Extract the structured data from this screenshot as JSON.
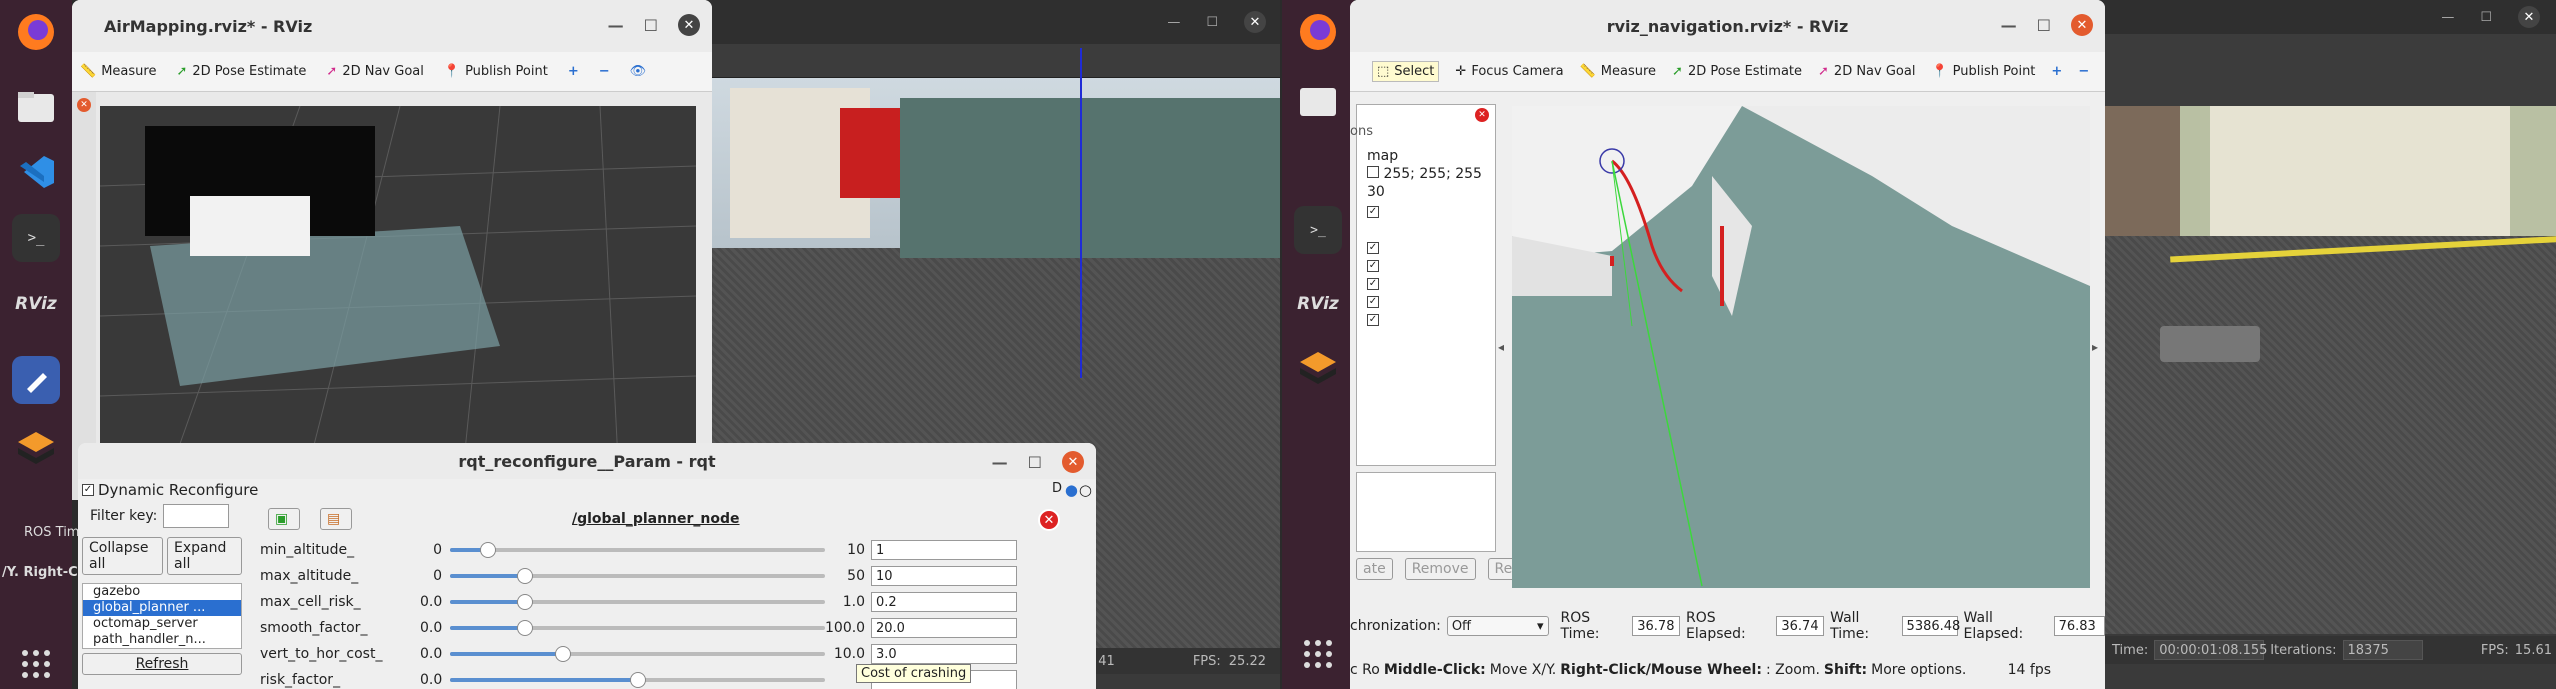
{
  "left_dock": {
    "apps": [
      "firefox-icon",
      "files-icon",
      "vscode-icon",
      "terminal-icon",
      "rviz-icon",
      "text-editor-icon",
      "ros-icon"
    ],
    "grid_label": "show-apps-icon"
  },
  "airmapping": {
    "title": "AirMapping.rviz* - RViz",
    "tools": [
      "Measure",
      "2D Pose Estimate",
      "2D Nav Goal",
      "Publish Point"
    ]
  },
  "bg_window_left": {
    "fps_label": "FPS:",
    "fps_value": "25.22",
    "partial_text": "ROS Tim",
    "partial_text2": "/Y. Right-C",
    "partial_num": "41"
  },
  "rqt": {
    "title": "rqt_reconfigure__Param - rqt",
    "plugin": "Dynamic Reconfigure",
    "d_badge": "D",
    "filter_label": "Filter key:",
    "collapse_label": "Collapse all",
    "expand_label": "Expand all",
    "tree": [
      "gazebo",
      "global_planner ...",
      "octomap_server",
      "path_handler_n..."
    ],
    "refresh_label": "Refresh",
    "node_name": "/global_planner_node",
    "params": [
      {
        "name": "min_altitude_",
        "min": "0",
        "max": "10",
        "value": "1",
        "fraction": 0.1
      },
      {
        "name": "max_altitude_",
        "min": "0",
        "max": "50",
        "value": "10",
        "fraction": 0.2
      },
      {
        "name": "max_cell_risk_",
        "min": "0.0",
        "max": "1.0",
        "value": "0.2",
        "fraction": 0.2
      },
      {
        "name": "smooth_factor_",
        "min": "0.0",
        "max": "100.0",
        "value": "20.0",
        "fraction": 0.2
      },
      {
        "name": "vert_to_hor_cost_",
        "min": "0.0",
        "max": "10.0",
        "value": "3.0",
        "fraction": 0.3
      },
      {
        "name": "risk_factor_",
        "min": "0.0",
        "max": "",
        "value": "",
        "fraction": 0.5
      }
    ],
    "tooltip": "Cost of crashing"
  },
  "nav": {
    "title": "rviz_navigation.rviz* - RViz",
    "tools": [
      "Select",
      "Focus Camera",
      "Measure",
      "2D Pose Estimate",
      "2D Nav Goal",
      "Publish Point"
    ],
    "display_items": [
      "map",
      "255; 255; 255",
      "30"
    ],
    "buttons": [
      "Remove",
      "Rename"
    ],
    "sync_label": "chronization:",
    "sync_value": "Off",
    "ros_time_label": "ROS Time:",
    "ros_time": "36.78",
    "ros_elapsed_label": "ROS Elapsed:",
    "ros_elapsed": "36.74",
    "wall_time_label": "Wall Time:",
    "wall_time": "5386.48",
    "wall_elapsed_label": "Wall Elapsed:",
    "wall_elapsed": "76.83",
    "hint_prefix": "Rotate.",
    "hint_bold1": "Middle-Click:",
    "hint_text1": "Move X/Y.",
    "hint_bold2": "Right-Click/Mouse Wheel:",
    "hint_text2": ": Zoom.",
    "hint_bold3": "Shift:",
    "hint_text3": "More options.",
    "fps": "14 fps",
    "partial_left1": "ons",
    "partial_left2": "ate",
    "partial_left3": "c Ro"
  },
  "bg_window_right": {
    "time_label": "Time:",
    "time_value": "00:00:01:08.155",
    "iter_label": "Iterations:",
    "iter_value": "18375",
    "fps_label": "FPS:",
    "fps_value": "15.61"
  }
}
